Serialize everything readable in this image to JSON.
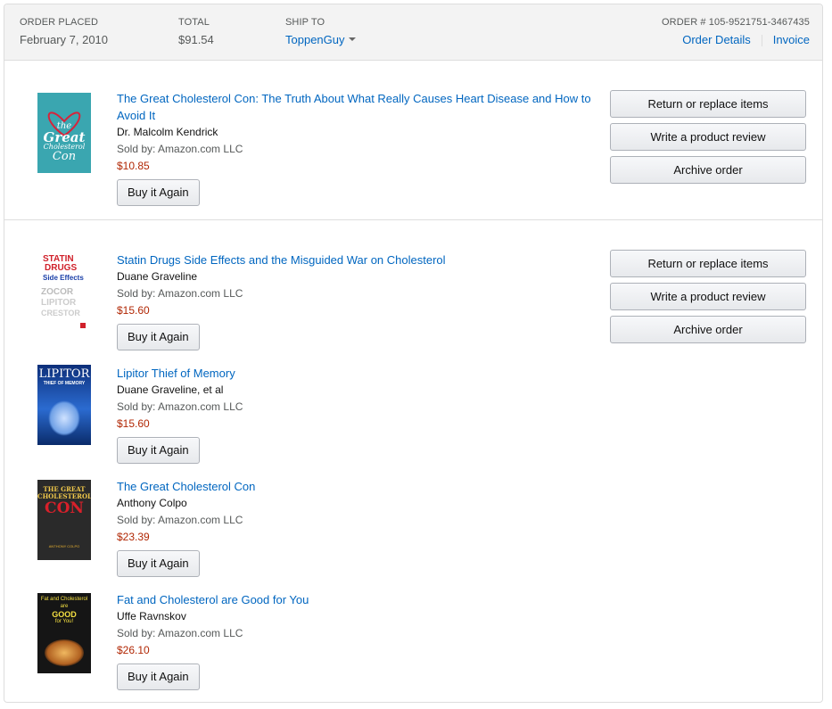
{
  "header": {
    "order_placed_label": "ORDER PLACED",
    "order_placed_value": "February 7, 2010",
    "total_label": "TOTAL",
    "total_value": "$91.54",
    "ship_to_label": "SHIP TO",
    "ship_to_value": "ToppenGuy",
    "order_number_label": "ORDER # 105-9521751-3467435",
    "order_details_link": "Order Details",
    "invoice_link": "Invoice"
  },
  "actions": {
    "return_label": "Return or replace items",
    "review_label": "Write a product review",
    "archive_label": "Archive order"
  },
  "items": [
    {
      "title": "The Great Cholesterol Con: The Truth About What Really Causes Heart Disease and How to Avoid It",
      "author": "Dr. Malcolm Kendrick",
      "sold_by": "Sold by: Amazon.com LLC",
      "price": "$10.85",
      "buy_label": "Buy it Again",
      "cover_text": [
        "the",
        "Great",
        "Cholesterol",
        "Con"
      ]
    },
    {
      "title": "Statin Drugs Side Effects and the Misguided War on Cholesterol",
      "author": "Duane Graveline",
      "sold_by": "Sold by: Amazon.com LLC",
      "price": "$15.60",
      "buy_label": "Buy it Again",
      "cover_text": [
        "STATIN",
        "DRUGS",
        "Side Effects",
        "ZOCOR",
        "LIPITOR",
        "CRESTOR"
      ]
    },
    {
      "title": "Lipitor Thief of Memory",
      "author": "Duane Graveline, et al",
      "sold_by": "Sold by: Amazon.com LLC",
      "price": "$15.60",
      "buy_label": "Buy it Again",
      "cover_text": [
        "LIPITOR",
        "THIEF OF MEMORY"
      ]
    },
    {
      "title": "The Great Cholesterol Con",
      "author": "Anthony Colpo",
      "sold_by": "Sold by: Amazon.com LLC",
      "price": "$23.39",
      "buy_label": "Buy it Again",
      "cover_text": [
        "THE GREAT",
        "CHOLESTEROL",
        "CON",
        "ANTHONY COLPO"
      ]
    },
    {
      "title": "Fat and Cholesterol are Good for You",
      "author": "Uffe Ravnskov",
      "sold_by": "Sold by: Amazon.com LLC",
      "price": "$26.10",
      "buy_label": "Buy it Again",
      "cover_text": [
        "Fat and Cholesterol",
        "are",
        "GOOD",
        "for You!"
      ]
    }
  ],
  "colors": {
    "link": "#0066c0",
    "price": "#b12704",
    "header_bg": "#f3f3f3"
  }
}
